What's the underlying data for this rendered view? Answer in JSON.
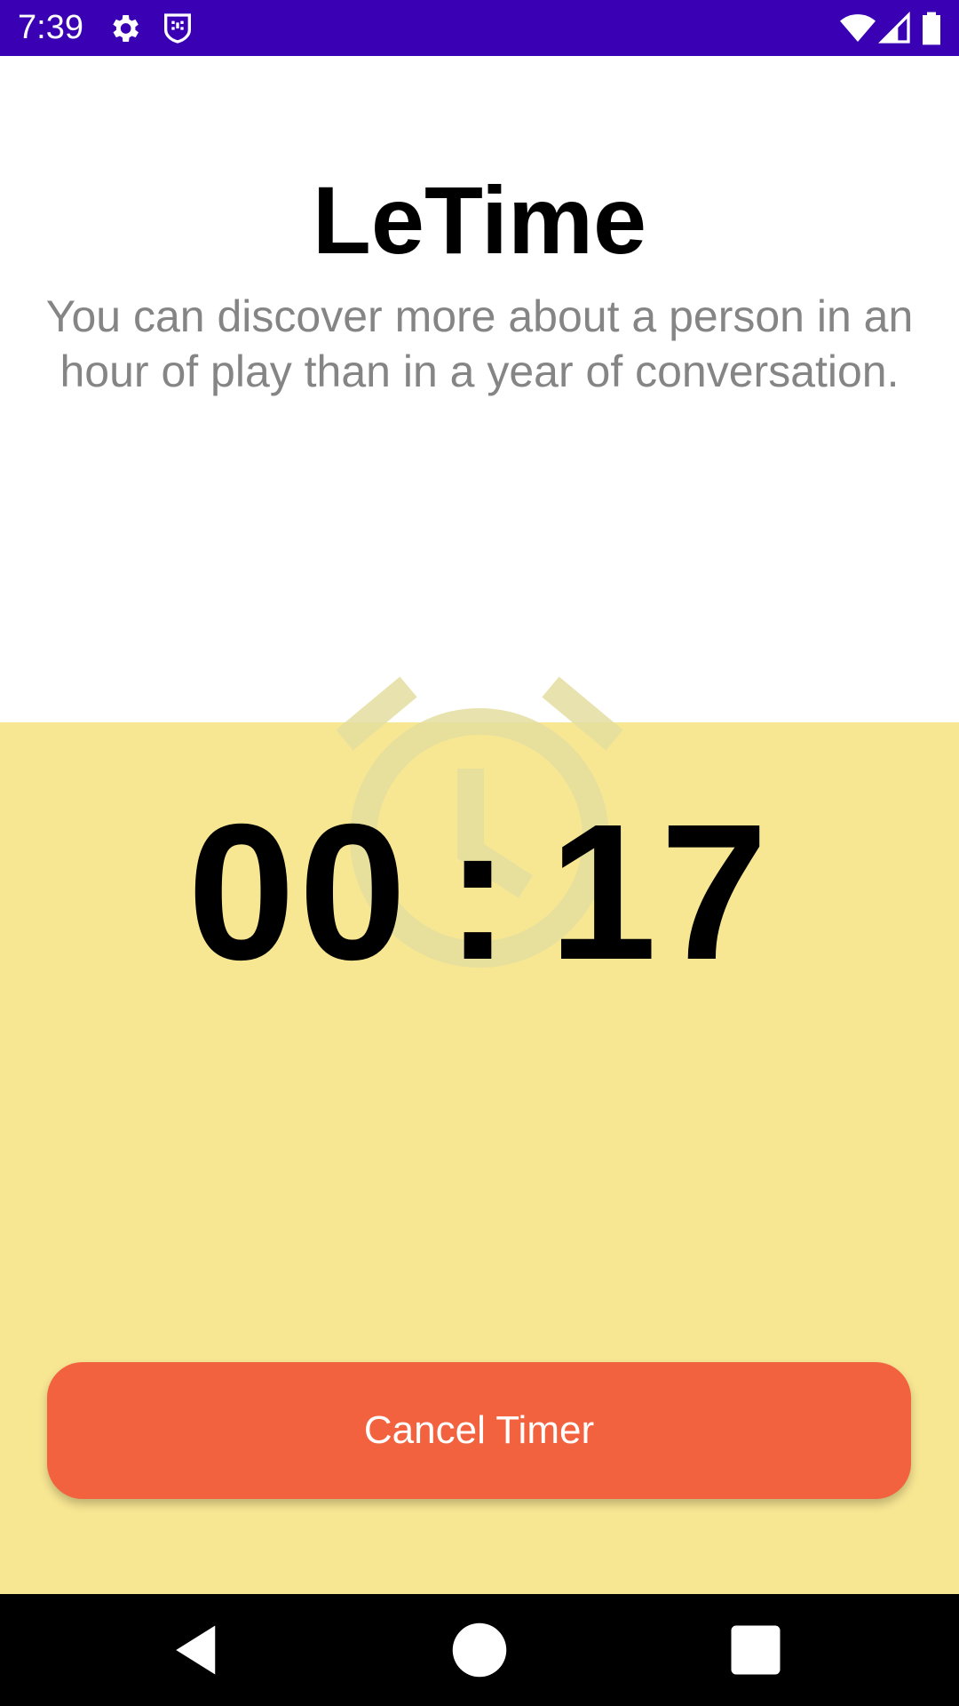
{
  "status_bar": {
    "time": "7:39",
    "background": "#3a00b4",
    "icons": [
      "gear-icon",
      "shield-icon",
      "wifi-icon",
      "signal-icon",
      "battery-icon"
    ]
  },
  "app": {
    "title": "LeTime",
    "quote": "You can discover more about a person in an hour of play than in a year of conversation."
  },
  "timer": {
    "minutes": "00",
    "separator": ":",
    "seconds": "17",
    "background": "#f7e692",
    "watermark_icon": "alarm-clock-icon"
  },
  "actions": {
    "cancel_label": "Cancel Timer",
    "cancel_color": "#f3623e"
  },
  "nav_bar": {
    "icons": [
      "back-icon",
      "home-icon",
      "recents-icon"
    ]
  }
}
